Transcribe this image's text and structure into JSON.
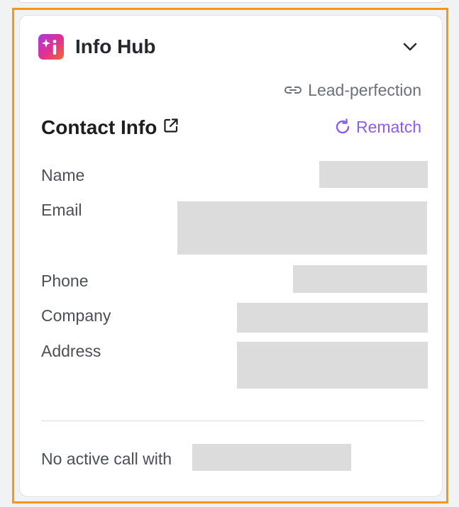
{
  "header": {
    "title": "Info Hub",
    "icon": "info-sparkle-icon",
    "toggle_icon": "chevron-down-icon"
  },
  "lead_link": {
    "icon": "link-icon",
    "label": "Lead-perfection"
  },
  "contact": {
    "title": "Contact Info",
    "external_icon": "external-link-icon",
    "rematch_label": "Rematch",
    "rematch_icon": "refresh-icon",
    "fields": [
      {
        "label": "Name",
        "value": ""
      },
      {
        "label": "Email",
        "value": ""
      },
      {
        "label": "Phone",
        "value": ""
      },
      {
        "label": "Company",
        "value": ""
      },
      {
        "label": "Address",
        "value": ""
      }
    ]
  },
  "call": {
    "status_text": "No active call with",
    "contact_name": ""
  },
  "colors": {
    "accent": "#8b5cf6",
    "highlight_border": "#ff9410",
    "redaction": "#dcdcdc"
  }
}
